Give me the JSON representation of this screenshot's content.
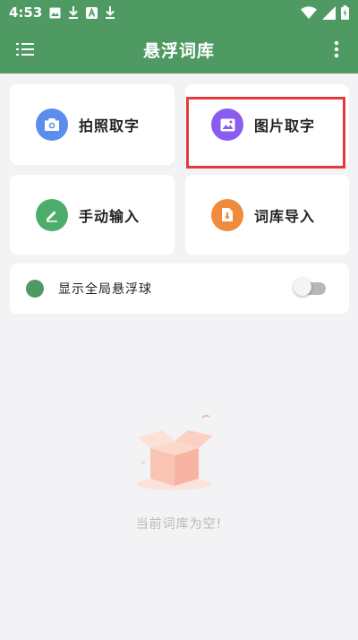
{
  "status_bar": {
    "time": "4:53",
    "icons_left": [
      "image-icon",
      "download-icon",
      "a-badge-icon",
      "download-icon"
    ],
    "icons_right": [
      "wifi-icon",
      "signal-icon",
      "battery-icon"
    ]
  },
  "app_bar": {
    "title": "悬浮词库",
    "menu_icon": "list-menu-icon",
    "more_icon": "more-vert-icon",
    "color": "#4f9a63"
  },
  "actions": [
    {
      "label": "拍照取字",
      "icon": "camera-icon",
      "color": "#5b8def"
    },
    {
      "label": "图片取字",
      "icon": "image-icon",
      "color": "#8b5cf0",
      "highlighted": true
    },
    {
      "label": "手动输入",
      "icon": "pencil-icon",
      "color": "#4cae6a"
    },
    {
      "label": "词库导入",
      "icon": "import-icon",
      "color": "#f08a3c"
    }
  ],
  "floating_ball": {
    "label": "显示全局悬浮球",
    "enabled": false
  },
  "empty_state": {
    "icon": "empty-box-icon",
    "text": "当前词库为空!"
  }
}
